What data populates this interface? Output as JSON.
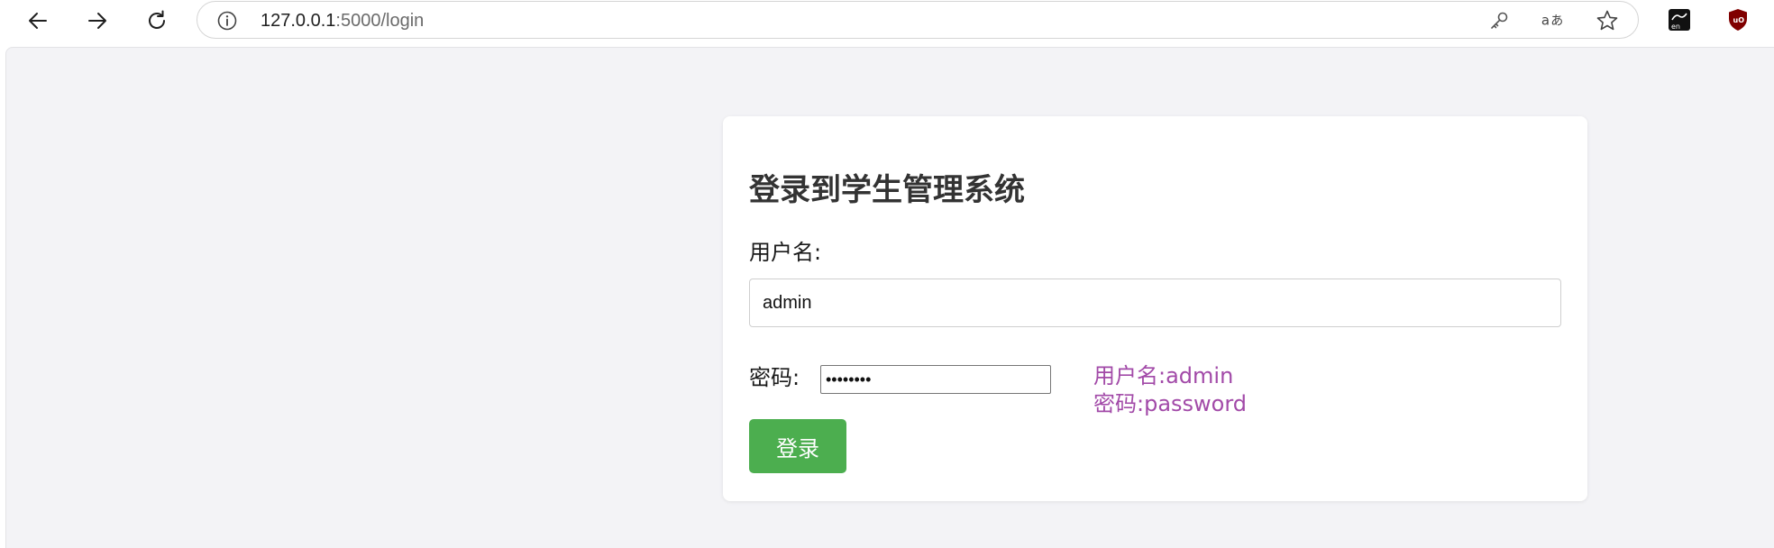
{
  "browser": {
    "url_host": "127.0.0.1",
    "url_rest": ":5000/login",
    "icons": {
      "back": "back-arrow-icon",
      "forward": "forward-arrow-icon",
      "reload": "reload-icon",
      "info": "info-icon",
      "passwords": "key-icon",
      "translate": "translate-icon",
      "favorite": "star-icon",
      "extension_1": "extension-translator-icon",
      "extension_2": "ublock-shield-icon"
    }
  },
  "login": {
    "title": "登录到学生管理系统",
    "username_label": "用户名:",
    "username_value": "admin",
    "password_label": "密码:",
    "password_value": "password",
    "hint_username": "用户名:admin",
    "hint_password": "密码:password",
    "submit_label": "登录"
  },
  "colors": {
    "page_background": "#f3f3f6",
    "card_background": "#ffffff",
    "title_text": "#333333",
    "hint_text": "#a24aa8",
    "button_background": "#4cae4f",
    "button_text": "#ffffff"
  }
}
